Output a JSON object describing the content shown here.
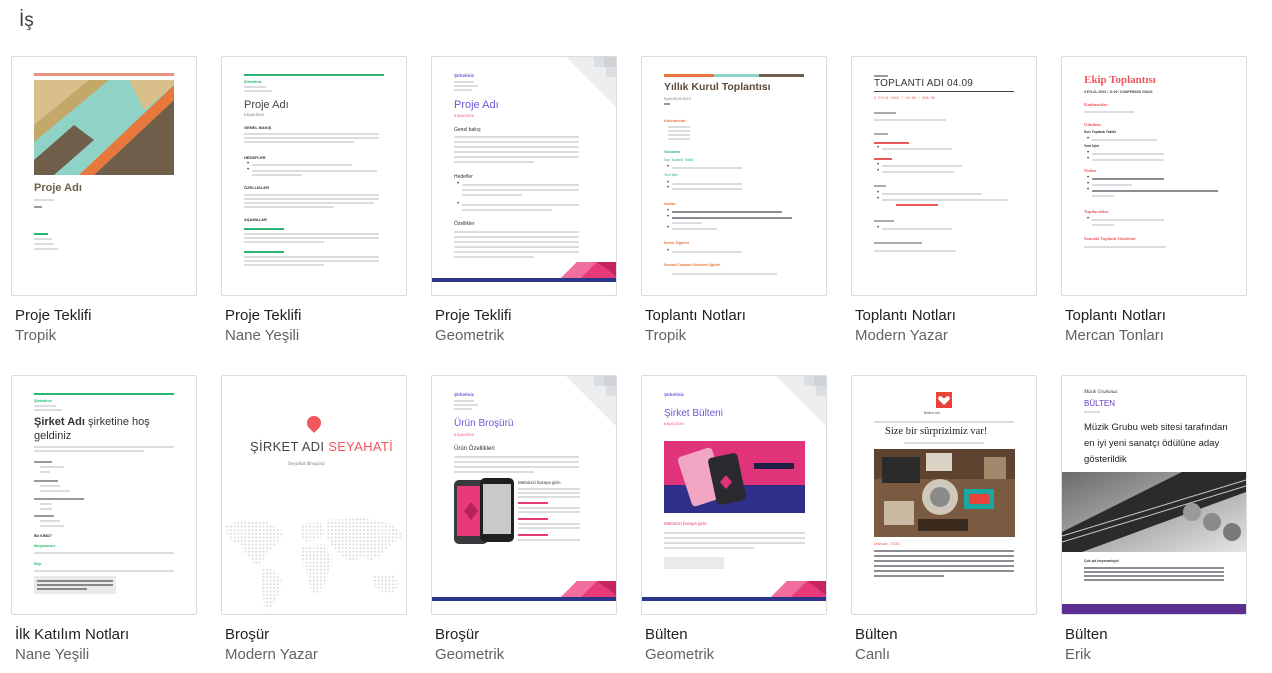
{
  "section_title": "İş",
  "templates": [
    {
      "title": "Proje Teklifi",
      "style": "Tropik",
      "page": {
        "heading": "Proje Adı"
      }
    },
    {
      "title": "Proje Teklifi",
      "style": "Nane Yeşili",
      "page": {
        "company": "Şirketiniz",
        "heading": "Proje Adı",
        "date": "8 Eylül 20XX",
        "section1": "GENEL BAKIŞ",
        "section2": "HEDEFLER",
        "section3": "ÖZELLİKLER",
        "section4": "AŞAMALAR"
      }
    },
    {
      "title": "Proje Teklifi",
      "style": "Geometrik",
      "page": {
        "company": "Şirketiniz",
        "heading": "Proje Adı",
        "date": "8 Eylül 20XX",
        "section1": "Genel bakış",
        "section2": "Hedefler",
        "section3": "Özellikler"
      }
    },
    {
      "title": "Toplantı Notları",
      "style": "Tropik",
      "page": {
        "heading": "Yıllık Kurul Toplantısı",
        "date": "Eylül 08.09.20XX",
        "label1": "Katılımcılar",
        "label2": "Gündem",
        "label3": "Son Toplantı Takibi",
        "label4": "Yeni İşler",
        "label5": "Notlar",
        "label6": "İşlem Öğeleri",
        "label7": "Sonraki Toplantı Gündemi Öğeleri"
      }
    },
    {
      "title": "Toplantı Notları",
      "style": "Modern Yazar",
      "page": {
        "heading": "TOPLANTI ADI 04.09",
        "meta": "9 EYLÜL 20XX / 10:00 / ODA NO"
      }
    },
    {
      "title": "Toplantı Notları",
      "style": "Mercan Tonları",
      "page": {
        "heading": "Ekip Toplantısı",
        "date": "9 EYLÜL 20XX / 11:00 / KONFERANS ODASI",
        "label1": "Katılımcılar",
        "label2": "Gündem",
        "label3": "Son Toplantı Takibi",
        "label4": "Yeni İşler",
        "label5": "Notlar",
        "label6": "Yapılacaklar",
        "label7": "Sonraki Toplantı Gündemi"
      }
    },
    {
      "title": "İlk Katılım Notları",
      "style": "Nane Yeşili",
      "page": {
        "company": "Şirketiniz",
        "heading_bold": "Şirket Adı",
        "heading_rest": "şirketine hoş",
        "heading_line2": "geldiniz",
        "label1": "Bİz KİMİZ?",
        "label2": "Misyonumuz",
        "label3": "Ekip"
      }
    },
    {
      "title": "Broşür",
      "style": "Modern Yazar",
      "page": {
        "heading_part1": "ŞİRKET ADI",
        "heading_part2": "SEYAHATİ",
        "subtitle": "Seyahat Broşürü"
      }
    },
    {
      "title": "Broşür",
      "style": "Geometrik",
      "page": {
        "company": "Şirketiniz",
        "heading": "Ürün Broşürü",
        "date": "8 Eylül 20XX",
        "section1": "Ürün Özellikleri",
        "item": "Metninizi buraya girin"
      }
    },
    {
      "title": "Bülten",
      "style": "Geometrik",
      "page": {
        "company": "Şirketiniz",
        "heading": "Şirket Bülteni",
        "date": "8 Eylül 20XX",
        "caption": "Metninizi buraya girin"
      }
    },
    {
      "title": "Bülten",
      "style": "Canlı",
      "page": {
        "brand": "Bülten adı",
        "heading": "Size bir sürprizimiz var!",
        "caption": "Ürün adı - 1TUS"
      }
    },
    {
      "title": "Bülten",
      "style": "Erik",
      "page": {
        "brand": "Müzik Grubunuz",
        "label": "BÜLTEN",
        "heading_line1": "Müzik Grubu web sitesi tarafından",
        "heading_line2": "en iyi yeni sanatçı ödülüne aday",
        "heading_line3": "gösterildik",
        "section": "Çok şık heyecanlıyız!"
      }
    }
  ],
  "colors": {
    "tropik_orange": "#e8773b",
    "tropik_teal": "#8fd3c7",
    "tropik_brown": "#6f5e4a",
    "mint": "#2bb673",
    "geo_purple": "#7254d6",
    "geo_navy": "#2a3489",
    "geo_pink": "#e83a79",
    "coral": "#f0575b"
  }
}
